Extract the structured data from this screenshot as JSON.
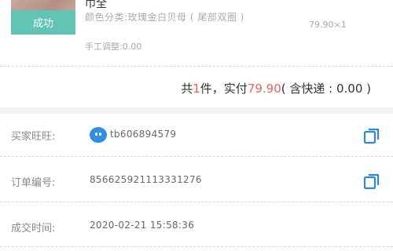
{
  "item": {
    "name": "巾全",
    "status_tag": "成功",
    "spec": "颜色分类:玫瑰金白贝母 ( 尾部双圈 )",
    "price_qty": "79.90×1",
    "adjust": "手工调整:0.00"
  },
  "summary": {
    "prefix": "共",
    "count": "1",
    "mid": "件，实付",
    "amount": "79.90",
    "suffix": "( 含快递 : 0.00 )"
  },
  "info": {
    "buyer": {
      "label": "买家旺旺:",
      "value": "tb606894579"
    },
    "order": {
      "label": "订单编号:",
      "value": "856625921113331276"
    },
    "time": {
      "label": "成交时间:",
      "value": "2020-02-21 15:58:36"
    }
  },
  "icons": {
    "buyer_chat": "wangwang-icon",
    "copy": "copy-icon"
  },
  "colors": {
    "accent": "#e0694c",
    "status_tag": "#62c4b4",
    "wangwang": "#2f8ee8",
    "copy_icon": "#2f86d8"
  }
}
